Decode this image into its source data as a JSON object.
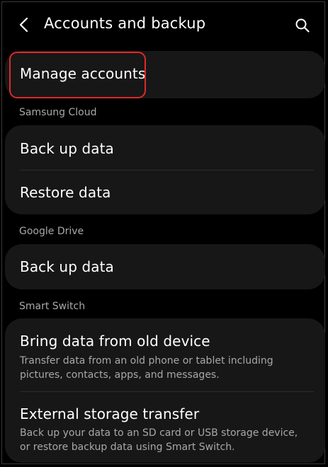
{
  "header": {
    "title": "Accounts and backup",
    "back_icon": "chevron-left-icon",
    "search_icon": "search-icon"
  },
  "manage_accounts": {
    "label": "Manage accounts"
  },
  "sections": {
    "samsung_cloud": {
      "header": "Samsung Cloud",
      "items": [
        {
          "label": "Back up data"
        },
        {
          "label": "Restore data"
        }
      ]
    },
    "google_drive": {
      "header": "Google Drive",
      "items": [
        {
          "label": "Back up data"
        }
      ]
    },
    "smart_switch": {
      "header": "Smart Switch",
      "items": [
        {
          "label": "Bring data from old device",
          "description": "Transfer data from an old phone or tablet including pictures, contacts, apps, and messages."
        },
        {
          "label": "External storage transfer",
          "description": "Back up your data to an SD card or USB storage device, or restore backup data using Smart Switch."
        }
      ]
    }
  },
  "colors": {
    "background": "#000000",
    "card": "#171717",
    "text_primary": "#ffffff",
    "text_secondary": "#a8a8a8",
    "highlight": "#e02828"
  }
}
